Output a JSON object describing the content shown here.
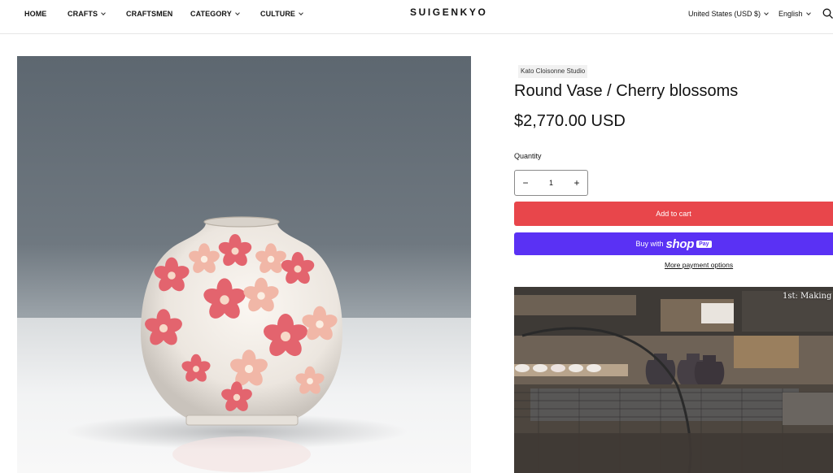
{
  "header": {
    "nav": [
      {
        "label": "HOME",
        "dropdown": false
      },
      {
        "label": "CRAFTS",
        "dropdown": true
      },
      {
        "label": "CRAFTSMEN",
        "dropdown": false
      },
      {
        "label": "CATEGORY",
        "dropdown": true
      },
      {
        "label": "CULTURE",
        "dropdown": true
      }
    ],
    "logo": "SUIGENKYO",
    "currency": "United States (USD $)",
    "language": "English",
    "icons": {
      "search": "search-icon",
      "chevron": "chevron-down-icon"
    }
  },
  "product": {
    "vendor": "Kato Cloisonne Studio",
    "title": "Round Vase / Cherry blossoms",
    "price": "$2,770.00 USD",
    "quantity_label": "Quantity",
    "quantity": "1",
    "minus": "−",
    "plus": "+",
    "add_to_cart": "Add to cart",
    "buy_with": "Buy with",
    "shop_word": "shop",
    "pay_badge": "Pay",
    "more_payment": "More payment options"
  },
  "video": {
    "caption": "1st:  Making"
  },
  "colors": {
    "add_to_cart": "#e8464b",
    "shop_pay": "#5a31f4",
    "text": "#121212"
  }
}
